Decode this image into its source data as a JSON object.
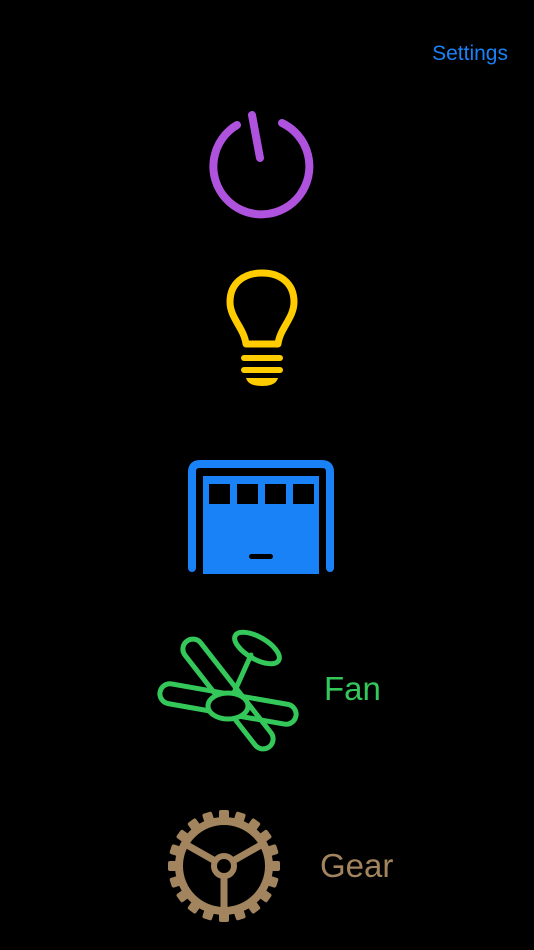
{
  "header": {
    "settings_label": "Settings"
  },
  "colors": {
    "background": "#000000",
    "link": "#1a82f7",
    "power": "#af52de",
    "light": "#ffcc00",
    "garage": "#1a82f7",
    "fan": "#34c759",
    "gear": "#a2845e"
  },
  "devices": [
    {
      "icon": "power-icon",
      "label": ""
    },
    {
      "icon": "light-bulb-icon",
      "label": ""
    },
    {
      "icon": "garage-door-icon",
      "label": ""
    },
    {
      "icon": "ceiling-fan-icon",
      "label": "Fan"
    },
    {
      "icon": "gear-icon",
      "label": "Gear"
    }
  ]
}
